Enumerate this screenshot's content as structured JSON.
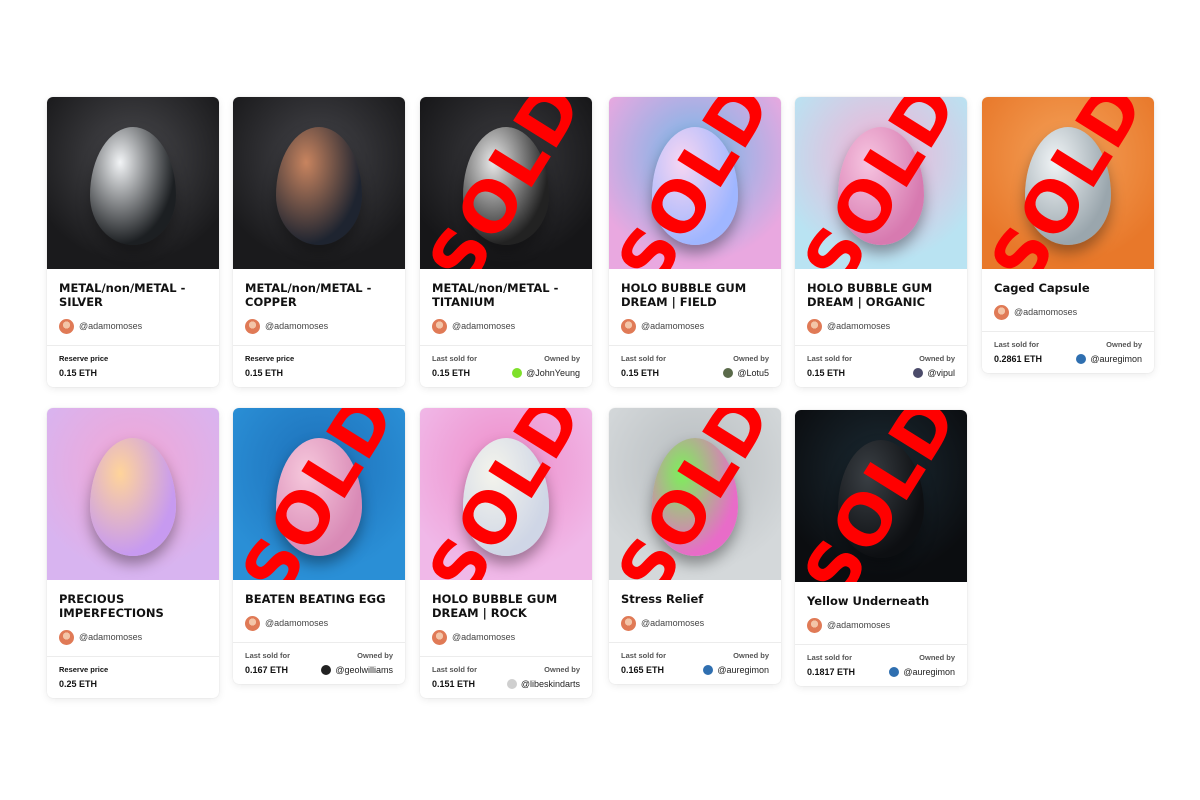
{
  "cards": [
    {
      "title": "METAL/non/METAL - SILVER",
      "creator": "@adamomoses",
      "status": "reserve",
      "price_label": "Reserve price",
      "price": "0.15 ETH",
      "sold": false,
      "colors": {
        "bg": "#1a1a1c",
        "bg2": "#4a4a4e",
        "egg1": "#f2f4f6",
        "egg2": "#1c1f22"
      }
    },
    {
      "title": "METAL/non/METAL - COPPER",
      "creator": "@adamomoses",
      "status": "reserve",
      "price_label": "Reserve price",
      "price": "0.15 ETH",
      "sold": false,
      "colors": {
        "bg": "#1a1a1c",
        "bg2": "#45454a",
        "egg1": "#c8845f",
        "egg2": "#1e2430"
      }
    },
    {
      "title": "METAL/non/METAL - TITANIUM",
      "creator": "@adamomoses",
      "status": "sold",
      "price_label": "Last sold for",
      "price": "0.15 ETH",
      "owned_label": "Owned by",
      "owner": "@JohnYeung",
      "owner_color": "#7ee02a",
      "sold": true,
      "sold_text": "SOLD",
      "colors": {
        "bg": "#161618",
        "bg2": "#3c3c40",
        "egg1": "#e8e8e8",
        "egg2": "#222"
      }
    },
    {
      "title": "HOLO BUBBLE GUM DREAM | FIELD",
      "creator": "@adamomoses",
      "status": "sold",
      "price_label": "Last sold for",
      "price": "0.15 ETH",
      "owned_label": "Owned by",
      "owner": "@Lotu5",
      "owner_color": "#5a6a4a",
      "sold": true,
      "sold_text": "SOLD",
      "colors": {
        "bg": "#e9a8e0",
        "bg2": "#6fb8e8",
        "egg1": "#f7d6f2",
        "egg2": "#9fb6ff"
      }
    },
    {
      "title": "HOLO BUBBLE GUM DREAM | ORGANIC",
      "creator": "@adamomoses",
      "status": "sold",
      "price_label": "Last sold for",
      "price": "0.15 ETH",
      "owned_label": "Owned by",
      "owner": "@vipul",
      "owner_color": "#4b4b6a",
      "sold": true,
      "sold_text": "SOLD",
      "colors": {
        "bg": "#b9e3f2",
        "bg2": "#f4b0d4",
        "egg1": "#f6c4e0",
        "egg2": "#d77ab0"
      }
    },
    {
      "title": "Caged Capsule",
      "creator": "@adamomoses",
      "status": "sold",
      "price_label": "Last sold for",
      "price": "0.2861 ETH",
      "owned_label": "Owned by",
      "owner": "@auregimon",
      "owner_color": "#2f6fb0",
      "sold": true,
      "sold_text": "SOLD",
      "colors": {
        "bg": "#e8782a",
        "bg2": "#f4a25a",
        "egg1": "#f0f4f6",
        "egg2": "#9aa6ad"
      }
    },
    {
      "title": "PRECIOUS IMPERFECTIONS",
      "creator": "@adamomoses",
      "status": "reserve",
      "price_label": "Reserve price",
      "price": "0.25 ETH",
      "sold": false,
      "colors": {
        "bg": "#d8b4f0",
        "bg2": "#f3a6d4",
        "egg1": "#ffd49a",
        "egg2": "#c79af0"
      }
    },
    {
      "title": "BEATEN BEATING EGG",
      "creator": "@adamomoses",
      "status": "sold",
      "price_label": "Last sold for",
      "price": "0.167 ETH",
      "owned_label": "Owned by",
      "owner": "@geolwilliams",
      "owner_color": "#222222",
      "sold": true,
      "sold_text": "SOLD",
      "colors": {
        "bg": "#2a8fd6",
        "bg2": "#1d6fb8",
        "egg1": "#f6c8dc",
        "egg2": "#d98ab6"
      }
    },
    {
      "title": "HOLO BUBBLE GUM DREAM | ROCK",
      "creator": "@adamomoses",
      "status": "sold",
      "price_label": "Last sold for",
      "price": "0.151 ETH",
      "owned_label": "Owned by",
      "owner": "@libeskindarts",
      "owner_color": "#cfcfcf",
      "sold": true,
      "sold_text": "SOLD",
      "colors": {
        "bg": "#f0b8e8",
        "bg2": "#ee8cc8",
        "egg1": "#f4f4ec",
        "egg2": "#cfd6e6"
      }
    },
    {
      "title": "Stress Relief",
      "creator": "@adamomoses",
      "status": "sold",
      "price_label": "Last sold for",
      "price": "0.165 ETH",
      "owned_label": "Owned by",
      "owner": "@auregimon",
      "owner_color": "#2f6fb0",
      "sold": true,
      "sold_text": "SOLD",
      "colors": {
        "bg": "#d4d8da",
        "bg2": "#b7bcbf",
        "egg1": "#7cf05a",
        "egg2": "#e86cc8"
      }
    },
    {
      "title": "Yellow Underneath",
      "creator": "@adamomoses",
      "status": "sold",
      "price_label": "Last sold for",
      "price": "0.1817 ETH",
      "owned_label": "Owned by",
      "owner": "@auregimon",
      "owner_color": "#2f6fb0",
      "sold": true,
      "sold_text": "SOLD",
      "colors": {
        "bg": "#0b0d10",
        "bg2": "#1b2a33",
        "egg1": "#3a3f44",
        "egg2": "#0d0f12"
      }
    }
  ]
}
